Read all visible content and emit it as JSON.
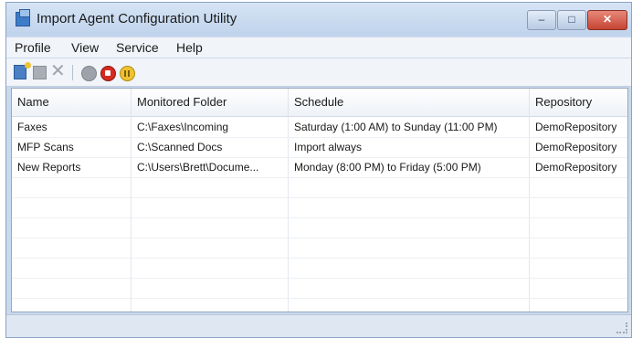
{
  "window": {
    "title": "Import Agent Configuration Utility"
  },
  "menu": [
    {
      "label": "Profile"
    },
    {
      "label": "View"
    },
    {
      "label": "Service"
    },
    {
      "label": "Help"
    }
  ],
  "toolbar": {
    "icons": [
      "new-profile-icon",
      "save-icon",
      "delete-icon",
      "settings-icon",
      "stop-service-icon",
      "pause-service-icon"
    ]
  },
  "table": {
    "columns": [
      "Name",
      "Monitored Folder",
      "Schedule",
      "Repository"
    ],
    "rows": [
      [
        "Faxes",
        "C:\\Faxes\\Incoming",
        "Saturday (1:00 AM) to Sunday (11:00 PM)",
        "DemoRepository"
      ],
      [
        "MFP Scans",
        "C:\\Scanned Docs",
        "Import always",
        "DemoRepository"
      ],
      [
        "New Reports",
        "C:\\Users\\Brett\\Docume...",
        "Monday (8:00 PM) to Friday (5:00 PM)",
        "DemoRepository"
      ]
    ]
  },
  "status": {
    "text": ""
  }
}
